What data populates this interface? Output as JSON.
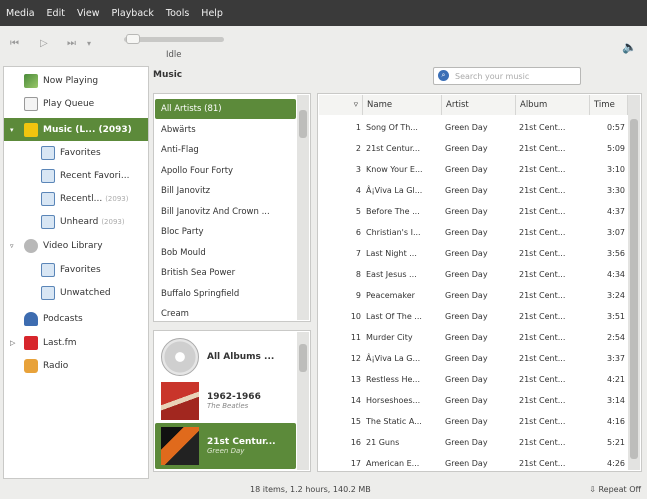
{
  "menu": [
    "Media",
    "Edit",
    "View",
    "Playback",
    "Tools",
    "Help"
  ],
  "player": {
    "state": "Idle"
  },
  "sidebar": {
    "items": [
      {
        "label": "Now Playing",
        "icon": "now-playing-icon"
      },
      {
        "label": "Play Queue",
        "icon": "play-queue-icon"
      },
      {
        "label": "Music (L... (2093)",
        "icon": "music-library-icon"
      },
      {
        "label": "Favorites",
        "icon": "smart-playlist-icon"
      },
      {
        "label": "Recent Favori...",
        "icon": "smart-playlist-icon"
      },
      {
        "label": "Recentl...",
        "sub": "(2093)",
        "icon": "smart-playlist-icon"
      },
      {
        "label": "Unheard",
        "sub": "(2093)",
        "icon": "smart-playlist-icon"
      },
      {
        "label": "Video Library",
        "icon": "video-library-icon"
      },
      {
        "label": "Favorites",
        "icon": "smart-playlist-icon"
      },
      {
        "label": "Unwatched",
        "icon": "smart-playlist-icon"
      },
      {
        "label": "Podcasts",
        "icon": "podcast-icon"
      },
      {
        "label": "Last.fm",
        "icon": "lastfm-icon"
      },
      {
        "label": "Radio",
        "icon": "radio-icon"
      }
    ]
  },
  "main": {
    "title": "Music",
    "search_placeholder": "Search your music"
  },
  "artists": [
    "All Artists (81)",
    "Abwärts",
    "Anti-Flag",
    "Apollo Four Forty",
    "Bill Janovitz",
    "Bill Janovitz And Crown ...",
    "Bloc Party",
    "Bob Mould",
    "British Sea Power",
    "Buffalo Springfield",
    "Cream"
  ],
  "albums": [
    {
      "title": "All Albums ...",
      "artist": ""
    },
    {
      "title": "1962-1966",
      "artist": "The Beatles"
    },
    {
      "title": "21st Centur...",
      "artist": "Green Day"
    }
  ],
  "table": {
    "headers": [
      "Name",
      "Artist",
      "Album",
      "Time"
    ],
    "rows": [
      {
        "num": "1",
        "name": "Song Of Th...",
        "artist": "Green Day",
        "album": "21st Cent...",
        "time": "0:57"
      },
      {
        "num": "2",
        "name": "21st Centur...",
        "artist": "Green Day",
        "album": "21st Cent...",
        "time": "5:09"
      },
      {
        "num": "3",
        "name": "Know Your E...",
        "artist": "Green Day",
        "album": "21st Cent...",
        "time": "3:10"
      },
      {
        "num": "4",
        "name": "Â¡Viva La Gl...",
        "artist": "Green Day",
        "album": "21st Cent...",
        "time": "3:30"
      },
      {
        "num": "5",
        "name": "Before The ...",
        "artist": "Green Day",
        "album": "21st Cent...",
        "time": "4:37"
      },
      {
        "num": "6",
        "name": "Christian's I...",
        "artist": "Green Day",
        "album": "21st Cent...",
        "time": "3:07"
      },
      {
        "num": "7",
        "name": "Last Night ...",
        "artist": "Green Day",
        "album": "21st Cent...",
        "time": "3:56"
      },
      {
        "num": "8",
        "name": "East Jesus ...",
        "artist": "Green Day",
        "album": "21st Cent...",
        "time": "4:34"
      },
      {
        "num": "9",
        "name": "Peacemaker",
        "artist": "Green Day",
        "album": "21st Cent...",
        "time": "3:24"
      },
      {
        "num": "10",
        "name": "Last Of The ...",
        "artist": "Green Day",
        "album": "21st Cent...",
        "time": "3:51"
      },
      {
        "num": "11",
        "name": "Murder City",
        "artist": "Green Day",
        "album": "21st Cent...",
        "time": "2:54"
      },
      {
        "num": "12",
        "name": "Â¡Viva La G...",
        "artist": "Green Day",
        "album": "21st Cent...",
        "time": "3:37"
      },
      {
        "num": "13",
        "name": "Restless He...",
        "artist": "Green Day",
        "album": "21st Cent...",
        "time": "4:21"
      },
      {
        "num": "14",
        "name": "Horseshoes...",
        "artist": "Green Day",
        "album": "21st Cent...",
        "time": "3:14"
      },
      {
        "num": "15",
        "name": "The Static A...",
        "artist": "Green Day",
        "album": "21st Cent...",
        "time": "4:16"
      },
      {
        "num": "16",
        "name": "21 Guns",
        "artist": "Green Day",
        "album": "21st Cent...",
        "time": "5:21"
      },
      {
        "num": "17",
        "name": "American E...",
        "artist": "Green Day",
        "album": "21st Cent...",
        "time": "4:26"
      }
    ]
  },
  "status": {
    "summary": "18 items, 1.2 hours, 140.2 MB",
    "repeat": "Repeat Off"
  },
  "colors": {
    "selection": "#5c8a3a",
    "menubar": "#3a3a3a",
    "background": "#ededeb"
  }
}
